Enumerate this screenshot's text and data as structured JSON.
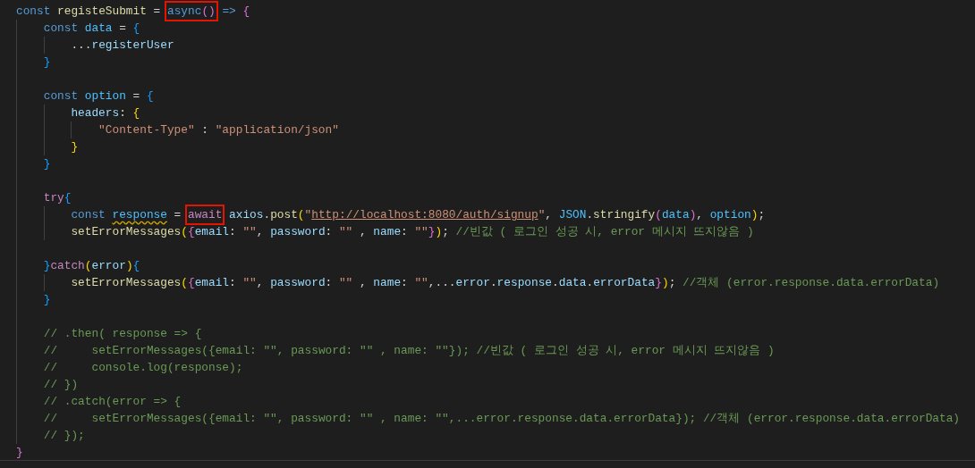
{
  "editor": {
    "lines": [
      {
        "tokens": [
          {
            "text": "const ",
            "kind": "kw"
          },
          {
            "text": "registeSubmit",
            "kind": "fn"
          },
          {
            "text": " = ",
            "kind": "punc"
          },
          {
            "boxed": true,
            "tokens": [
              {
                "text": "async",
                "kind": "kw"
              },
              {
                "text": "()",
                "kind": "brA"
              }
            ]
          },
          {
            "text": " => ",
            "kind": "kw"
          },
          {
            "text": "{",
            "kind": "brA"
          }
        ]
      },
      {
        "tokens": [
          {
            "text": "    const ",
            "kind": "kw"
          },
          {
            "text": "data",
            "kind": "const"
          },
          {
            "text": " = ",
            "kind": "punc"
          },
          {
            "text": "{",
            "kind": "brB"
          }
        ]
      },
      {
        "tokens": [
          {
            "text": "        ...",
            "kind": "punc"
          },
          {
            "text": "registerUser",
            "kind": "var"
          }
        ]
      },
      {
        "tokens": [
          {
            "text": "    }",
            "kind": "brB"
          }
        ]
      },
      {
        "kind": "blank"
      },
      {
        "tokens": [
          {
            "text": "    const ",
            "kind": "kw"
          },
          {
            "text": "option",
            "kind": "const"
          },
          {
            "text": " = ",
            "kind": "punc"
          },
          {
            "text": "{",
            "kind": "brB"
          }
        ]
      },
      {
        "tokens": [
          {
            "text": "        headers",
            "kind": "var"
          },
          {
            "text": ": ",
            "kind": "punc"
          },
          {
            "text": "{",
            "kind": "brC"
          }
        ]
      },
      {
        "tokens": [
          {
            "text": "            \"Content-Type\"",
            "kind": "str"
          },
          {
            "text": " : ",
            "kind": "punc"
          },
          {
            "text": "\"application/json\"",
            "kind": "str"
          }
        ]
      },
      {
        "tokens": [
          {
            "text": "        }",
            "kind": "brC"
          }
        ]
      },
      {
        "tokens": [
          {
            "text": "    }",
            "kind": "brB"
          }
        ]
      },
      {
        "kind": "blank"
      },
      {
        "tokens": [
          {
            "text": "    try",
            "kind": "ctrl"
          },
          {
            "text": "{",
            "kind": "brB"
          }
        ]
      },
      {
        "tokens": [
          {
            "text": "        const ",
            "kind": "kw"
          },
          {
            "text": "response",
            "kind": "const",
            "warning": true
          },
          {
            "text": " = ",
            "kind": "punc"
          },
          {
            "boxed": true,
            "tokens": [
              {
                "text": "await",
                "kind": "ctrl"
              }
            ]
          },
          {
            "text": " axios",
            "kind": "var"
          },
          {
            "text": ".",
            "kind": "punc"
          },
          {
            "text": "post",
            "kind": "fn"
          },
          {
            "text": "(",
            "kind": "brC"
          },
          {
            "text": "\"",
            "kind": "str"
          },
          {
            "text": "http://localhost:8080/auth/signup",
            "kind": "link"
          },
          {
            "text": "\"",
            "kind": "str"
          },
          {
            "text": ", ",
            "kind": "punc"
          },
          {
            "text": "JSON",
            "kind": "const"
          },
          {
            "text": ".",
            "kind": "punc"
          },
          {
            "text": "stringify",
            "kind": "fn"
          },
          {
            "text": "(",
            "kind": "brA"
          },
          {
            "text": "data",
            "kind": "const"
          },
          {
            "text": ")",
            "kind": "brA"
          },
          {
            "text": ", ",
            "kind": "punc"
          },
          {
            "text": "option",
            "kind": "const"
          },
          {
            "text": ")",
            "kind": "brC"
          },
          {
            "text": ";",
            "kind": "punc"
          }
        ]
      },
      {
        "tokens": [
          {
            "text": "        setErrorMessages",
            "kind": "fn"
          },
          {
            "text": "(",
            "kind": "brC"
          },
          {
            "text": "{",
            "kind": "brA"
          },
          {
            "text": "email",
            "kind": "var"
          },
          {
            "text": ": ",
            "kind": "punc"
          },
          {
            "text": "\"\"",
            "kind": "str"
          },
          {
            "text": ", ",
            "kind": "punc"
          },
          {
            "text": "password",
            "kind": "var"
          },
          {
            "text": ": ",
            "kind": "punc"
          },
          {
            "text": "\"\"",
            "kind": "str"
          },
          {
            "text": " , ",
            "kind": "punc"
          },
          {
            "text": "name",
            "kind": "var"
          },
          {
            "text": ": ",
            "kind": "punc"
          },
          {
            "text": "\"\"",
            "kind": "str"
          },
          {
            "text": "}",
            "kind": "brA"
          },
          {
            "text": ")",
            "kind": "brC"
          },
          {
            "text": "; ",
            "kind": "punc"
          },
          {
            "text": "//빈값 ( 로그인 성공 시, error 메시지 뜨지않음 )",
            "kind": "cmt"
          }
        ]
      },
      {
        "kind": "blank"
      },
      {
        "tokens": [
          {
            "text": "    }",
            "kind": "brB"
          },
          {
            "text": "catch",
            "kind": "ctrl"
          },
          {
            "text": "(",
            "kind": "brC"
          },
          {
            "text": "error",
            "kind": "var"
          },
          {
            "text": ")",
            "kind": "brC"
          },
          {
            "text": "{",
            "kind": "brB"
          }
        ]
      },
      {
        "tokens": [
          {
            "text": "        setErrorMessages",
            "kind": "fn"
          },
          {
            "text": "(",
            "kind": "brC"
          },
          {
            "text": "{",
            "kind": "brA"
          },
          {
            "text": "email",
            "kind": "var"
          },
          {
            "text": ": ",
            "kind": "punc"
          },
          {
            "text": "\"\"",
            "kind": "str"
          },
          {
            "text": ", ",
            "kind": "punc"
          },
          {
            "text": "password",
            "kind": "var"
          },
          {
            "text": ": ",
            "kind": "punc"
          },
          {
            "text": "\"\"",
            "kind": "str"
          },
          {
            "text": " , ",
            "kind": "punc"
          },
          {
            "text": "name",
            "kind": "var"
          },
          {
            "text": ": ",
            "kind": "punc"
          },
          {
            "text": "\"\"",
            "kind": "str"
          },
          {
            "text": ",...",
            "kind": "punc"
          },
          {
            "text": "error",
            "kind": "var"
          },
          {
            "text": ".",
            "kind": "punc"
          },
          {
            "text": "response",
            "kind": "var"
          },
          {
            "text": ".",
            "kind": "punc"
          },
          {
            "text": "data",
            "kind": "var"
          },
          {
            "text": ".",
            "kind": "punc"
          },
          {
            "text": "errorData",
            "kind": "var"
          },
          {
            "text": "}",
            "kind": "brA"
          },
          {
            "text": ")",
            "kind": "brC"
          },
          {
            "text": "; ",
            "kind": "punc"
          },
          {
            "text": "//객체 (error.response.data.errorData)",
            "kind": "cmt"
          }
        ]
      },
      {
        "tokens": [
          {
            "text": "    }",
            "kind": "brB"
          }
        ]
      },
      {
        "kind": "blank"
      },
      {
        "tokens": [
          {
            "text": "    // .then( response => {",
            "kind": "cmt"
          }
        ]
      },
      {
        "tokens": [
          {
            "text": "    //     setErrorMessages({email: \"\", password: \"\" , name: \"\"}); //빈값 ( 로그인 성공 시, error 메시지 뜨지않음 )",
            "kind": "cmt"
          }
        ]
      },
      {
        "tokens": [
          {
            "text": "    //     console.log(response);",
            "kind": "cmt"
          }
        ]
      },
      {
        "tokens": [
          {
            "text": "    // })",
            "kind": "cmt"
          }
        ]
      },
      {
        "tokens": [
          {
            "text": "    // .catch(error => {",
            "kind": "cmt"
          }
        ]
      },
      {
        "tokens": [
          {
            "text": "    //     setErrorMessages({email: \"\", password: \"\" , name: \"\",...error.response.data.errorData}); //객체 (error.response.data.errorData)",
            "kind": "cmt"
          }
        ]
      },
      {
        "tokens": [
          {
            "text": "    // });",
            "kind": "cmt"
          }
        ]
      },
      {
        "tokens": [
          {
            "text": "}",
            "kind": "brA"
          }
        ]
      }
    ]
  }
}
